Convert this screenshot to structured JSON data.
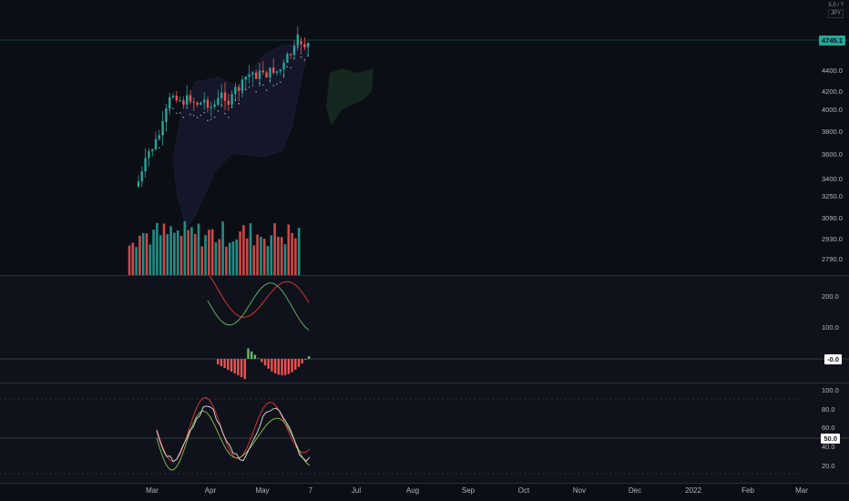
{
  "header": {
    "scale_mode": "5.0 / ?",
    "currency": "JPY"
  },
  "colors": {
    "background": "#0c0e15",
    "up": "#26a69a",
    "down": "#ef5350",
    "signal_red": "#e53935",
    "signal_green": "#66bb6a",
    "rsi_line": "#e0e0e0",
    "price_line": "#26a69a"
  },
  "main_pane": {
    "last_price": "4745.1",
    "price_axis_labels": [
      "4745.1",
      "4400.0",
      "4200.0",
      "4000.0",
      "3800.0",
      "3600.0",
      "3400.0",
      "3250.0",
      "3090.0",
      "2930.0",
      "2790.0"
    ]
  },
  "oscillator_pane": {
    "axis_labels": [
      "200.0",
      "100.0"
    ],
    "zero_label": "-0.0"
  },
  "rsi_pane": {
    "axis_labels": [
      "100.0",
      "80.0",
      "60.0",
      "50.0",
      "40.0",
      "20.0"
    ],
    "current_label": "50.0"
  },
  "time_axis": {
    "labels": [
      "Mar",
      "Apr",
      "May",
      "7",
      "Jul",
      "Aug",
      "Sep",
      "Oct",
      "Nov",
      "Dec",
      "2022",
      "Feb",
      "Mar"
    ]
  }
}
